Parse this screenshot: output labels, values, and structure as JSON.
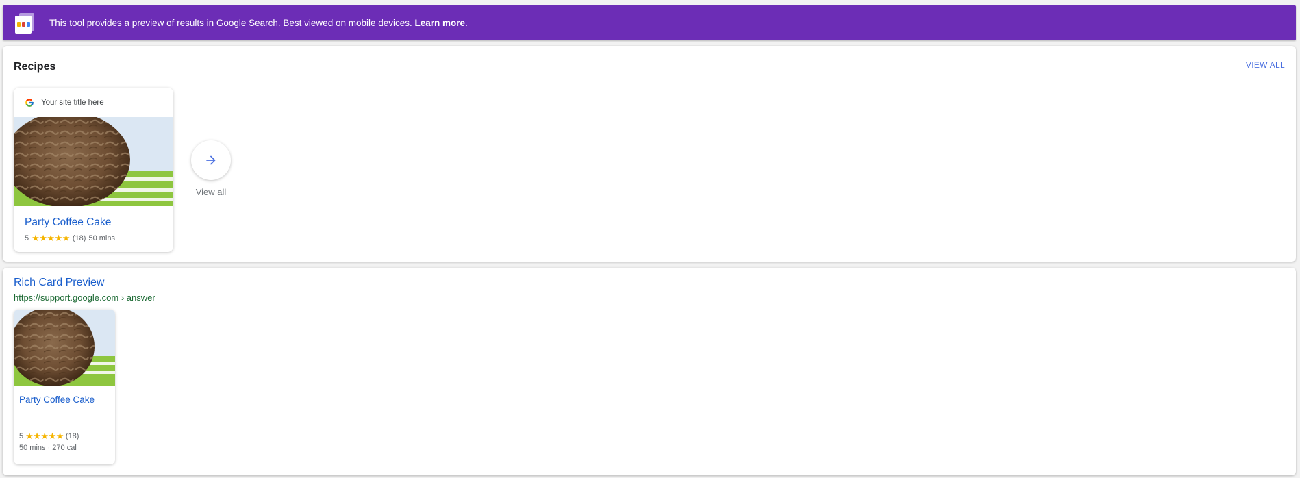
{
  "banner": {
    "text": "This tool provides a preview of results in Google Search. Best viewed on mobile devices.",
    "link": "Learn more",
    "period": ".",
    "logo_icon": "preview-tool-icon"
  },
  "recipes": {
    "title": "Recipes",
    "view_all_link": "VIEW ALL",
    "card": {
      "site_title": "Your site title here",
      "icon": "google-g-icon",
      "recipe_title": "Party Coffee Cake",
      "rating": "5",
      "stars": "★★★★★",
      "reviews": "(18)",
      "time": "50 mins"
    },
    "arrow_icon": "arrow-right-icon",
    "arrow_label": "View all"
  },
  "rich_card": {
    "title": "Rich Card Preview",
    "url": "https://support.google.com › answer",
    "card": {
      "recipe_title": "Party Coffee Cake",
      "rating": "5",
      "stars": "★★★★★",
      "reviews": "(18)",
      "details": "50 mins · 270 cal"
    }
  },
  "colors": {
    "banner": "#6c2db6",
    "link_blue": "#1a5ecc",
    "url_green": "#1e6b35",
    "star": "#f5b400"
  }
}
